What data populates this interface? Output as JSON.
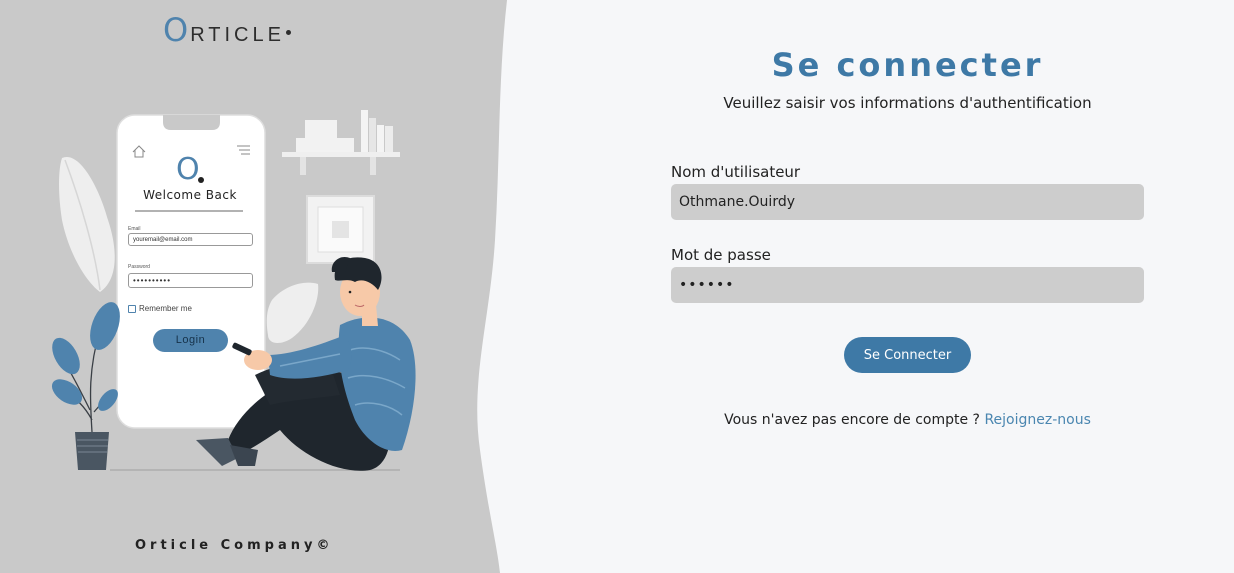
{
  "brand": {
    "logo_letter": "O",
    "logo_rest": "RTICLE",
    "footer": "Orticle Company©"
  },
  "phone_mockup": {
    "logo": "O",
    "welcome": "Welcome Back",
    "email_label": "Email",
    "email_value": "youremail@email.com",
    "password_label": "Password",
    "password_value": "••••••••••",
    "remember": "Remember me",
    "login_button": "Login"
  },
  "login": {
    "title": "Se connecter",
    "subtitle": "Veuillez saisir vos informations d'authentification",
    "username_label": "Nom d'utilisateur",
    "username_value": "Othmane.Ouirdy",
    "password_label": "Mot de passe",
    "password_value": "••••••",
    "submit_label": "Se Connecter",
    "signup_prompt": "Vous n'avez pas encore de compte ?",
    "signup_link": "Rejoignez-nous"
  },
  "colors": {
    "accent": "#3e79a6",
    "left_panel_bg": "#c9c9c9",
    "right_panel_bg": "#f6f7f9",
    "input_bg": "#cdcdcd"
  }
}
